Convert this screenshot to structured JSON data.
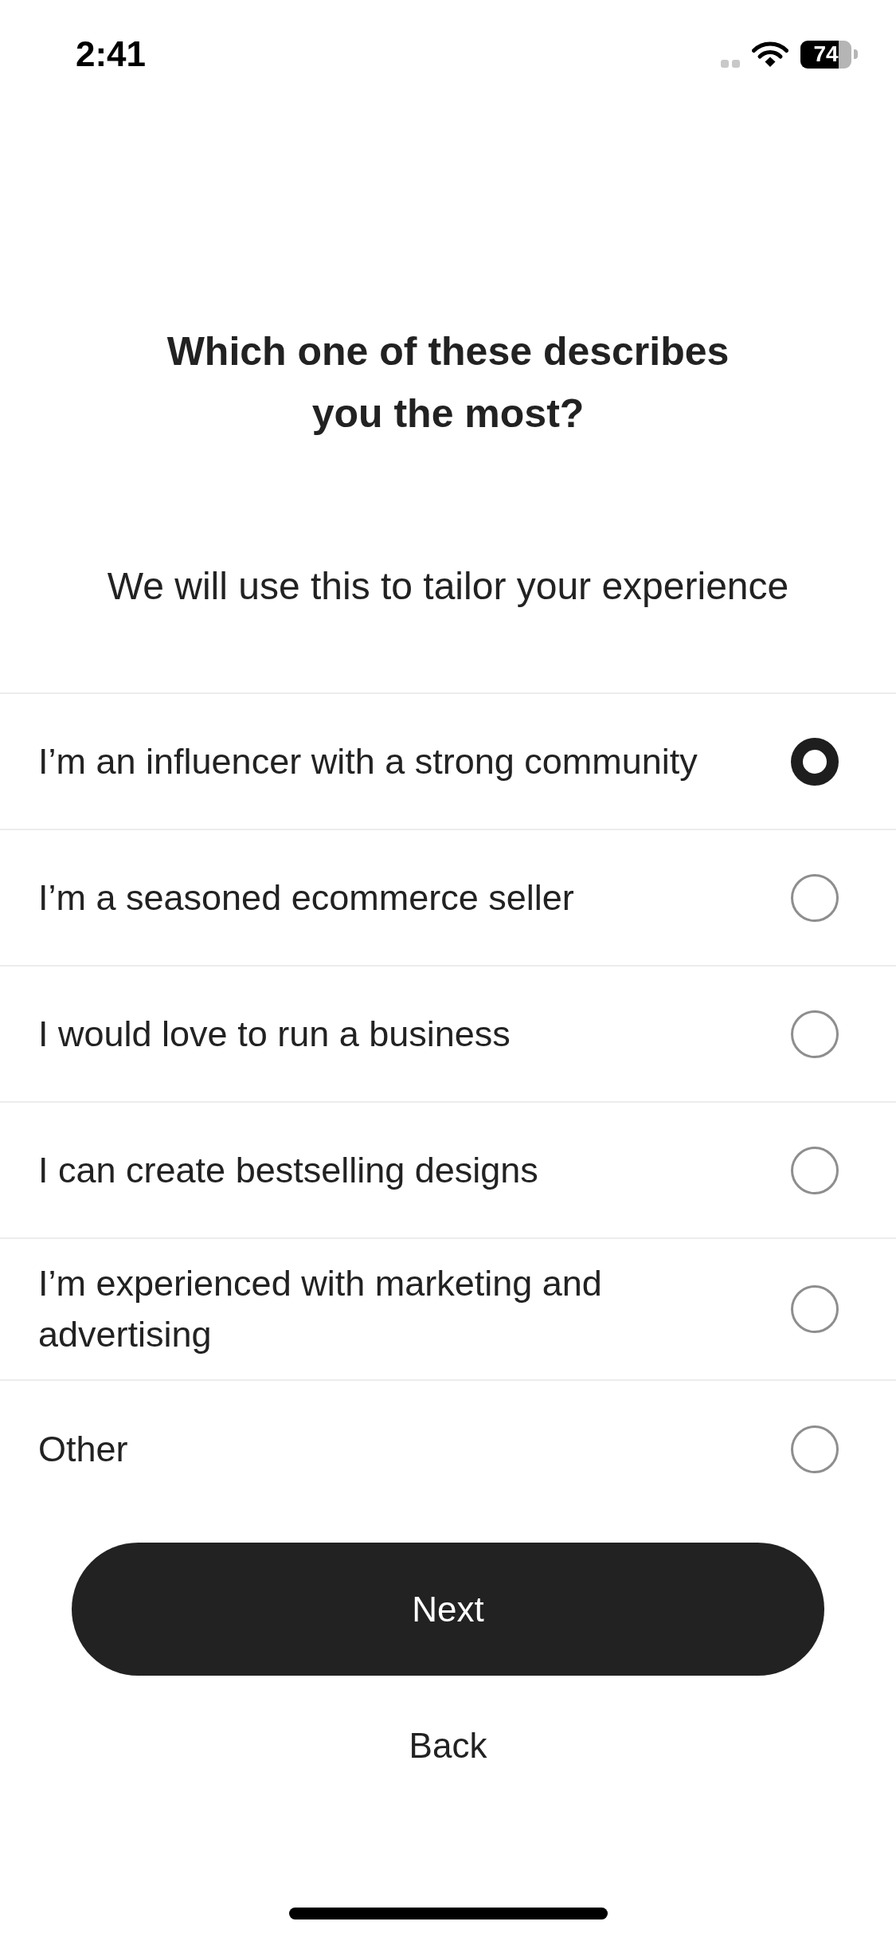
{
  "status_bar": {
    "time": "2:41",
    "battery": "74"
  },
  "question": {
    "title": "Which one of these describes you the most?",
    "subtitle": "We will use this to tailor your experience"
  },
  "options": [
    {
      "label": "I’m an influencer with a strong community",
      "selected": true
    },
    {
      "label": "I’m a seasoned ecommerce seller",
      "selected": false
    },
    {
      "label": "I would love to run a business",
      "selected": false
    },
    {
      "label": "I can create bestselling designs",
      "selected": false
    },
    {
      "label": "I’m experienced with marketing and advertising",
      "selected": false
    },
    {
      "label": "Other",
      "selected": false
    }
  ],
  "buttons": {
    "next": "Next",
    "back": "Back"
  }
}
